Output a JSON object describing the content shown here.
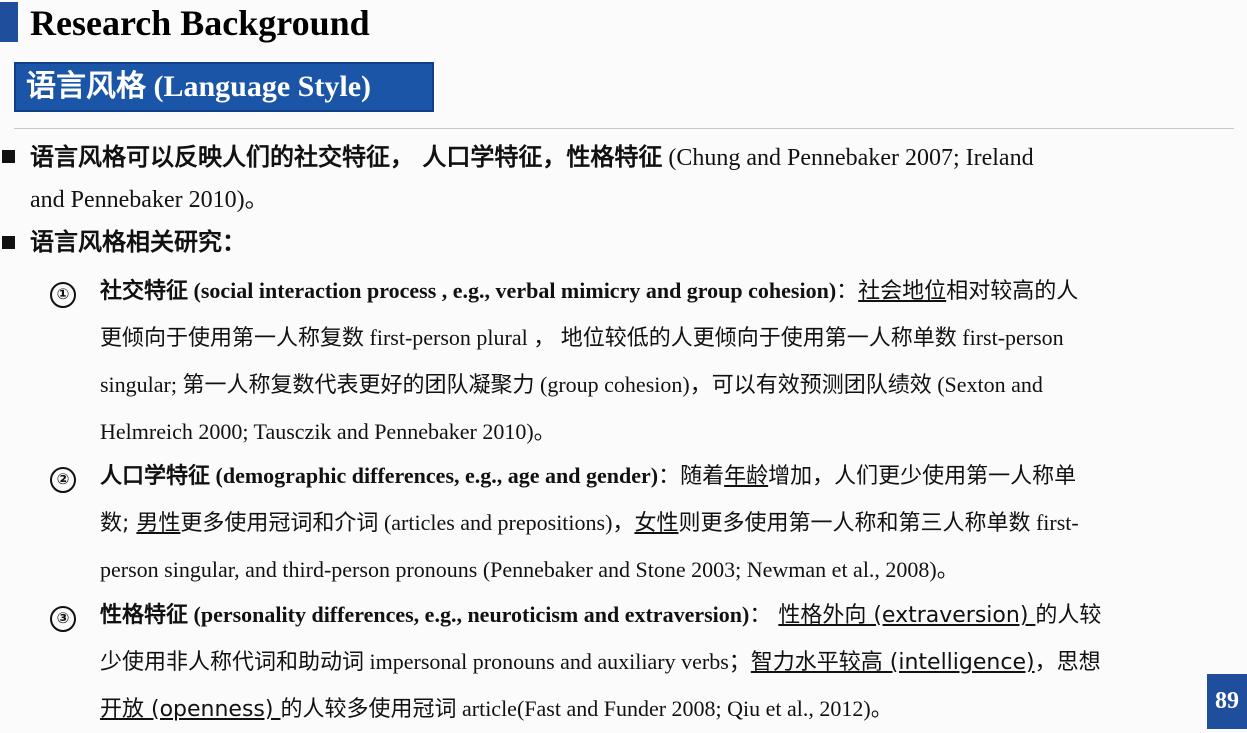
{
  "title": "Research Background",
  "section": "语言风格 (Language Style)",
  "bullet1": {
    "lead": "语言风格可以反映人们的社交特征， 人口学特征，性格特征",
    "cite_line1": " (Chung and Pennebaker 2007; Ireland",
    "cite_line2": "and Pennebaker 2010)。"
  },
  "bullet2": {
    "text": "语言风格相关研究："
  },
  "items": [
    {
      "num": "①",
      "l1_bold": "社交特征",
      "l1_paren": " (social interaction process , e.g., verbal mimicry and group cohesion)",
      "l1_colon": "：",
      "l1_u": "社会地位",
      "l1_rest": "相对较高的人",
      "l2_a": "更倾向于使用第一人称复数",
      "l2_b": " first-person plural ， ",
      "l2_c": "地位较低的人更倾向于使用第一人称单数",
      "l2_d": " first-person",
      "l3_a": "singular; ",
      "l3_b": "第一人称复数代表更好的团队凝聚力",
      "l3_c": " (group cohesion)",
      "l3_d": "，可以有效预测团队绩效",
      "l3_e": " (Sexton and",
      "l4": "Helmreich 2000; Tausczik and Pennebaker 2010)。"
    },
    {
      "num": "②",
      "l1_bold": "人口学特征",
      "l1_paren": " (demographic differences, e.g., age and gender)",
      "l1_colon": "：",
      "l1_a": "随着",
      "l1_u": "年龄",
      "l1_rest": "增加，人们更少使用第一人称单",
      "l2_a": "数; ",
      "l2_u": "男性",
      "l2_b": "更多使用冠词和介词",
      "l2_c": " (articles and prepositions)，",
      "l2_u2": "女性",
      "l2_d": "则更多使用第一人称和第三人称单数",
      "l2_e": " first-",
      "l3": "person singular, and third-person pronouns (Pennebaker and Stone 2003; Newman et al., 2008)。"
    },
    {
      "num": "③",
      "l1_bold": "性格特征",
      "l1_paren": " (personality differences, e.g., neuroticism and extraversion)",
      "l1_colon": "： ",
      "l1_u": "性格外向 (extraversion) ",
      "l1_rest": "的人较",
      "l2_a": "少使用非人称代词和助动词",
      "l2_b": " impersonal pronouns and auxiliary verbs；",
      "l2_u": "智力水平较高 (intelligence)",
      "l2_c": "，思想",
      "l3_u": "开放 (openness) ",
      "l3_a": "的人较多使用冠词",
      "l3_b": " article(Fast and Funder 2008; Qiu et al., 2012)。"
    }
  ],
  "page_number": "89"
}
